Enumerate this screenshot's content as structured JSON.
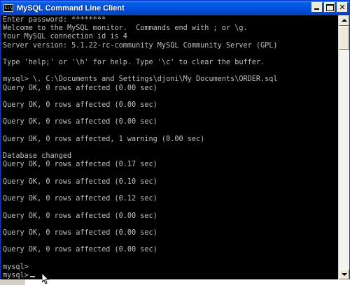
{
  "window": {
    "title": "MySQL Command Line Client",
    "icon": "console-app-icon",
    "icon_text": "C:\\"
  },
  "title_controls": {
    "minimize_icon": "minimize-icon",
    "maximize_icon": "maximize-icon",
    "close_glyph": "✕"
  },
  "console": {
    "lines": [
      "Enter password: ********",
      "Welcome to the MySQL monitor.  Commands end with ; or \\g.",
      "Your MySQL connection id is 4",
      "Server version: 5.1.22-rc-community MySQL Community Server (GPL)",
      "",
      "Type 'help;' or '\\h' for help. Type '\\c' to clear the buffer.",
      "",
      "mysql> \\. C:\\Documents and Settings\\djoni\\My Documents\\ORDER.sql",
      "Query OK, 0 rows affected (0.00 sec)",
      "",
      "Query OK, 0 rows affected (0.00 sec)",
      "",
      "Query OK, 0 rows affected (0.00 sec)",
      "",
      "Query OK, 0 rows affected, 1 warning (0.00 sec)",
      "",
      "Database changed",
      "Query OK, 0 rows affected (0.17 sec)",
      "",
      "Query OK, 0 rows affected (0.10 sec)",
      "",
      "Query OK, 0 rows affected (0.12 sec)",
      "",
      "Query OK, 0 rows affected (0.00 sec)",
      "",
      "Query OK, 0 rows affected (0.00 sec)",
      "",
      "Query OK, 0 rows affected (0.00 sec)",
      "",
      "mysql>",
      "mysql>"
    ],
    "text_color": "#c0c0c0",
    "background": "#000000"
  },
  "scrollbar": {
    "up_icon": "scroll-up-arrow-icon",
    "down_icon": "scroll-down-arrow-icon"
  },
  "colors": {
    "titlebar_accent": "#0054e3",
    "frame": "#0831d9"
  }
}
